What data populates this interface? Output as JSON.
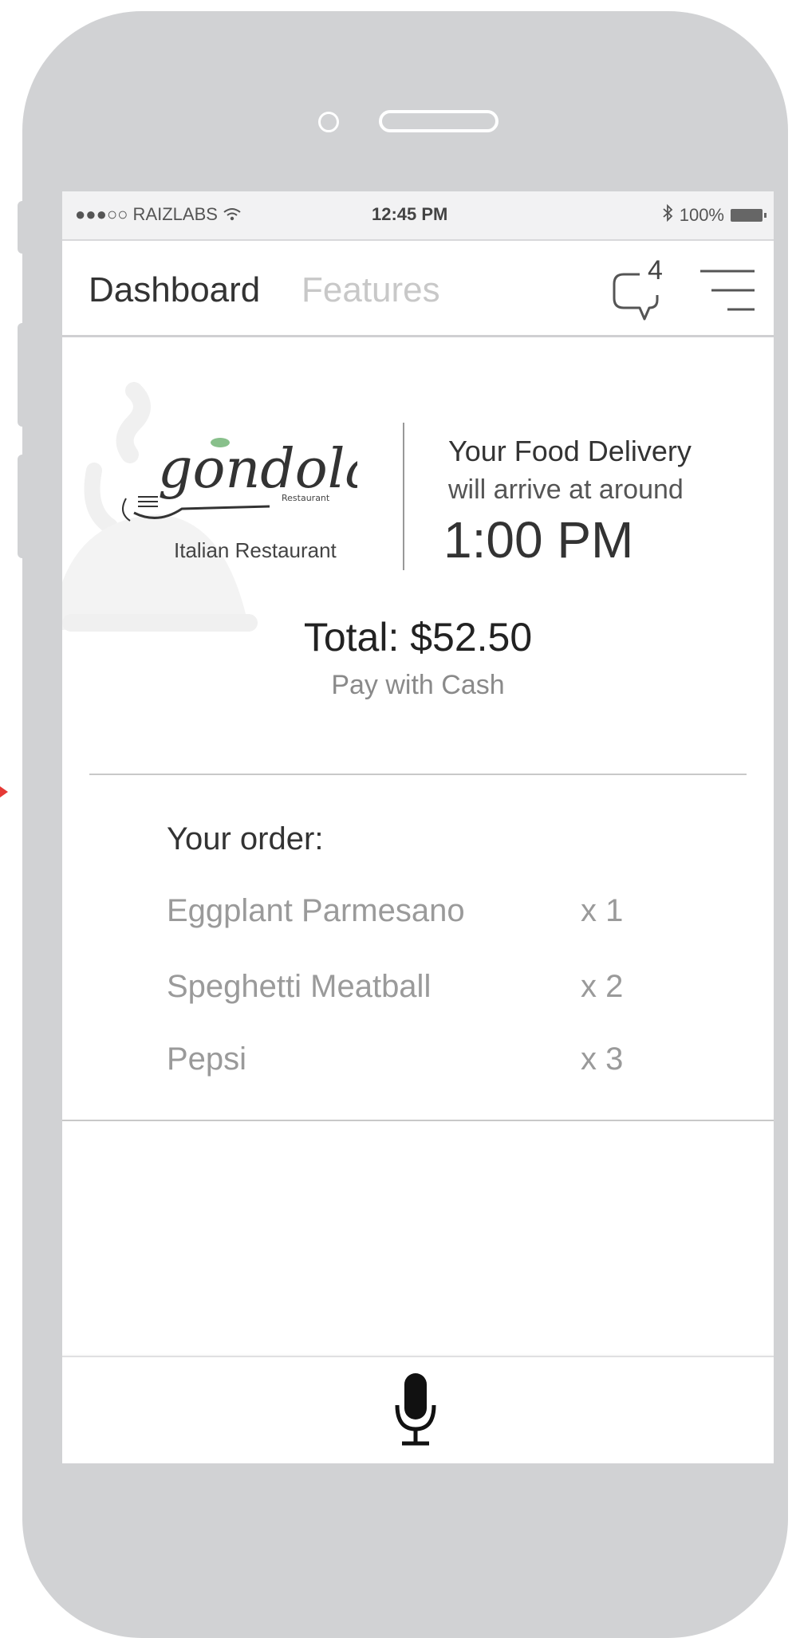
{
  "status_bar": {
    "carrier": "●●●○○ RAIZLABS",
    "time": "12:45 PM",
    "battery": "100%"
  },
  "nav": {
    "active_tab": "Dashboard",
    "tab": "Features",
    "chat_count": "4"
  },
  "restaurant": {
    "logo_text": "gondola",
    "logo_small": "Restaurant",
    "subtitle": "Italian Restaurant"
  },
  "delivery": {
    "title": "Your Food Delivery",
    "subtitle": "will arrive at around",
    "time": "1:00 PM"
  },
  "payment": {
    "total": "Total: $52.50",
    "method": "Pay with Cash"
  },
  "order": {
    "title": "Your order:",
    "items": [
      {
        "name": "Eggplant Parmesano",
        "qty": "x 1"
      },
      {
        "name": "Speghetti Meatball",
        "qty": "x 2"
      },
      {
        "name": "Pepsi",
        "qty": "x 3"
      }
    ]
  },
  "icons": {
    "chat": "chat-bubble-icon",
    "menu": "hamburger-menu-icon",
    "mic": "microphone-icon",
    "wifi": "wifi-icon",
    "bluetooth": "bluetooth-icon",
    "battery": "battery-icon"
  },
  "colors": {
    "phone_body": "#d1d2d4",
    "text_dark": "#333333",
    "text_muted": "#9a9a9a",
    "logo_accent": "#6ab06e"
  }
}
